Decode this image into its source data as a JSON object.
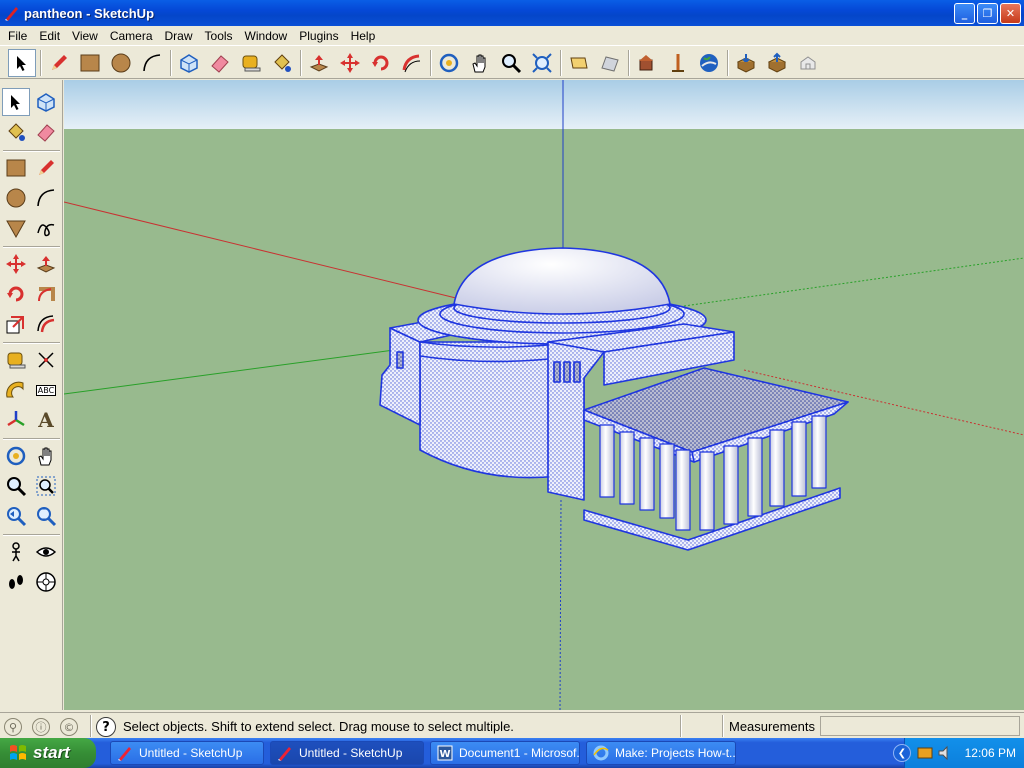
{
  "window": {
    "title": "pantheon - SketchUp",
    "minimize": "_",
    "maximize": "❐",
    "close": "✕"
  },
  "menu": [
    "File",
    "Edit",
    "View",
    "Camera",
    "Draw",
    "Tools",
    "Window",
    "Plugins",
    "Help"
  ],
  "top_toolbar": [
    {
      "name": "select-tool",
      "icon": "arrow-cursor-icon",
      "active": true
    },
    {
      "name": "pencil-tool",
      "icon": "pencil-icon"
    },
    {
      "name": "rectangle-tool",
      "icon": "rectangle-icon"
    },
    {
      "name": "circle-tool",
      "icon": "circle-icon"
    },
    {
      "name": "arc-tool",
      "icon": "arc-icon"
    },
    {
      "name": "make-component-tool",
      "icon": "component-icon"
    },
    {
      "name": "eraser-tool",
      "icon": "eraser-icon"
    },
    {
      "name": "tape-measure-tool",
      "icon": "tape-measure-icon"
    },
    {
      "name": "paint-bucket-tool",
      "icon": "paint-bucket-icon"
    },
    {
      "name": "push-pull-tool",
      "icon": "push-pull-icon"
    },
    {
      "name": "move-tool",
      "icon": "move-icon"
    },
    {
      "name": "rotate-tool",
      "icon": "rotate-icon"
    },
    {
      "name": "follow-me-tool",
      "icon": "follow-me-icon"
    },
    {
      "name": "orbit-tool",
      "icon": "orbit-icon"
    },
    {
      "name": "pan-tool",
      "icon": "hand-icon"
    },
    {
      "name": "zoom-tool",
      "icon": "magnifier-icon"
    },
    {
      "name": "zoom-extents-tool",
      "icon": "zoom-extents-icon"
    },
    {
      "name": "previous-view-tool",
      "icon": "previous-icon"
    },
    {
      "name": "next-view-tool",
      "icon": "next-icon"
    },
    {
      "name": "get-current-view-tool",
      "icon": "house-location-icon"
    },
    {
      "name": "toggle-terrain-tool",
      "icon": "terrain-icon"
    },
    {
      "name": "google-earth-tool",
      "icon": "globe-icon"
    },
    {
      "name": "get-models-tool",
      "icon": "download-icon"
    },
    {
      "name": "share-model-tool",
      "icon": "upload-icon"
    },
    {
      "name": "share-component-tool",
      "icon": "share-icon"
    }
  ],
  "left_toolbar": [
    {
      "name": "select-tool",
      "icon": "arrow-cursor-icon",
      "active": true
    },
    {
      "name": "make-component-tool",
      "icon": "component-icon"
    },
    {
      "name": "paint-bucket-tool",
      "icon": "paint-bucket-icon"
    },
    {
      "name": "eraser-tool",
      "icon": "eraser-icon"
    },
    {
      "name": "rectangle-tool",
      "icon": "rectangle-icon"
    },
    {
      "name": "line-tool",
      "icon": "pencil-icon"
    },
    {
      "name": "circle-tool",
      "icon": "circle-icon"
    },
    {
      "name": "arc-tool",
      "icon": "arc-icon"
    },
    {
      "name": "polygon-tool",
      "icon": "polygon-icon"
    },
    {
      "name": "freehand-tool",
      "icon": "freehand-icon"
    },
    {
      "name": "move-tool",
      "icon": "move-icon"
    },
    {
      "name": "push-pull-tool",
      "icon": "push-pull-icon"
    },
    {
      "name": "rotate-tool",
      "icon": "rotate-icon"
    },
    {
      "name": "follow-me-tool",
      "icon": "follow-me-icon"
    },
    {
      "name": "scale-tool",
      "icon": "scale-icon"
    },
    {
      "name": "offset-tool",
      "icon": "offset-icon"
    },
    {
      "name": "tape-measure-tool",
      "icon": "tape-measure-icon"
    },
    {
      "name": "dimension-tool",
      "icon": "dimension-icon"
    },
    {
      "name": "protractor-tool",
      "icon": "protractor-icon"
    },
    {
      "name": "text-tool",
      "icon": "text-icon"
    },
    {
      "name": "axes-tool",
      "icon": "axes-icon"
    },
    {
      "name": "3d-text-tool",
      "icon": "3d-text-icon"
    },
    {
      "name": "orbit-tool",
      "icon": "orbit-icon"
    },
    {
      "name": "pan-tool",
      "icon": "hand-icon"
    },
    {
      "name": "zoom-tool",
      "icon": "magnifier-icon"
    },
    {
      "name": "zoom-window-tool",
      "icon": "zoom-window-icon"
    },
    {
      "name": "previous-view-tool",
      "icon": "previous-icon"
    },
    {
      "name": "zoom-extents-tool",
      "icon": "zoom-extents-icon"
    },
    {
      "name": "position-camera-tool",
      "icon": "position-camera-icon"
    },
    {
      "name": "look-around-tool",
      "icon": "eye-icon"
    },
    {
      "name": "walk-tool",
      "icon": "footprints-icon"
    },
    {
      "name": "section-plane-tool",
      "icon": "section-plane-icon"
    }
  ],
  "left_toolbar_text": {
    "text_tool_label": "ABC",
    "axes_label_a": "A"
  },
  "status": {
    "message": "Select objects. Shift to extend select. Drag mouse to select multiple.",
    "help": "?",
    "measurements_label": "Measurements",
    "measurements_value": ""
  },
  "taskbar": {
    "start": "start",
    "tasks": [
      {
        "label": "Untitled - SketchUp",
        "icon": "sketchup-icon",
        "active": false
      },
      {
        "label": "Untitled - SketchUp",
        "icon": "sketchup-icon",
        "active": true
      },
      {
        "label": "Document1 - Microsof...",
        "icon": "word-icon",
        "active": false
      },
      {
        "label": "Make: Projects How-t...",
        "icon": "ie-icon",
        "active": false
      }
    ],
    "clock": "12:06 PM"
  },
  "colors": {
    "sky": "#d4e6f1",
    "ground": "#98ba8e",
    "selection_blue": "#1f36e0",
    "axis_red": "#c83232",
    "axis_green": "#28a028",
    "axis_blue": "#2040c8"
  }
}
